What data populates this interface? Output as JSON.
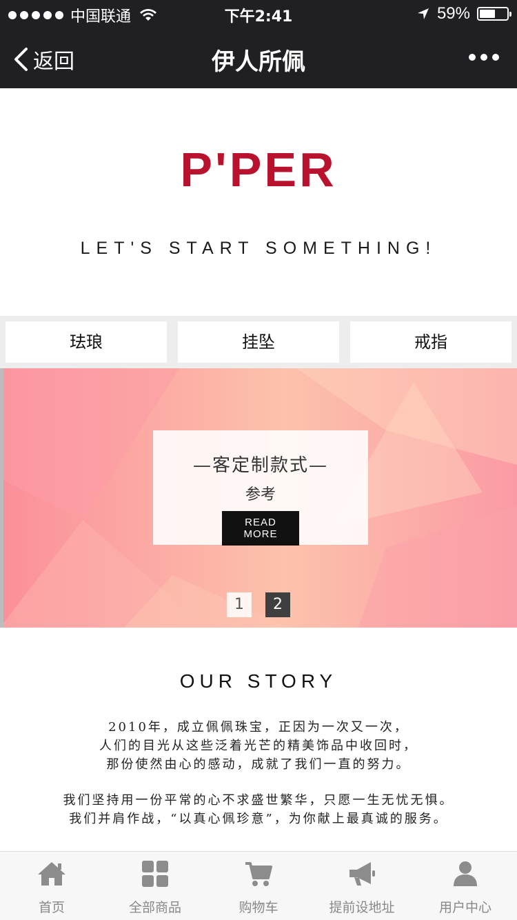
{
  "status_bar": {
    "carrier": "中国联通",
    "time": "下午2:41",
    "battery": "59%",
    "battery_level": 0.59
  },
  "nav": {
    "back_label": "返回",
    "title": "伊人所佩"
  },
  "brand": {
    "logo": "P'PER",
    "slogan": "LET'S START SOMETHING!",
    "color": "#b8122e"
  },
  "categories": [
    "珐琅",
    "挂坠",
    "戒指"
  ],
  "banner": {
    "title": "—客定制款式—",
    "subtitle": "参考",
    "button": "READ MORE",
    "pages": [
      "1",
      "2"
    ],
    "active_page": "2"
  },
  "story": {
    "title": "OUR STORY",
    "lines": [
      "2010年，成立佩佩珠宝，正因为一次又一次，",
      "人们的目光从这些泛着光芒的精美饰品中收回时，",
      "那份使然由心的感动，成就了我们一直的努力。",
      "我们坚持用一份平常的心不求盛世繁华，只愿一生无忧无惧。",
      "我们并肩作战，“以真心佩珍意”，为你献上最真诚的服务。"
    ]
  },
  "tabs": [
    {
      "label": "首页",
      "icon": "home-icon"
    },
    {
      "label": "全部商品",
      "icon": "grid-icon"
    },
    {
      "label": "购物车",
      "icon": "cart-icon"
    },
    {
      "label": "提前设地址",
      "icon": "megaphone-icon"
    },
    {
      "label": "用户中心",
      "icon": "user-icon"
    }
  ]
}
